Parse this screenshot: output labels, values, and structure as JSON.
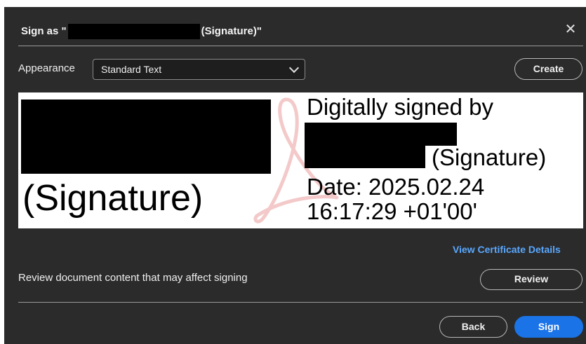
{
  "dialog": {
    "title_prefix": "Sign as \"",
    "title_suffix": "(Signature)\"",
    "close_glyph": "✕"
  },
  "appearance": {
    "label": "Appearance",
    "selected": "Standard Text",
    "create_label": "Create"
  },
  "preview": {
    "name_text": "(Signature)",
    "digitally_signed_by": "Digitally signed by",
    "signature_suffix": "(Signature)",
    "date_line": "Date: 2025.02.24",
    "time_line": "16:17:29 +01'00'",
    "watermark_icon": "acrobat-logo-watermark"
  },
  "certificate": {
    "link_label": "View Certificate Details"
  },
  "review": {
    "text": "Review document content that may affect signing",
    "button_label": "Review"
  },
  "footer": {
    "back_label": "Back",
    "sign_label": "Sign"
  },
  "colors": {
    "dialog_bg": "#2b2b2b",
    "primary": "#1b73e8",
    "link": "#5aa8ff",
    "watermark": "#f3c9c9"
  }
}
